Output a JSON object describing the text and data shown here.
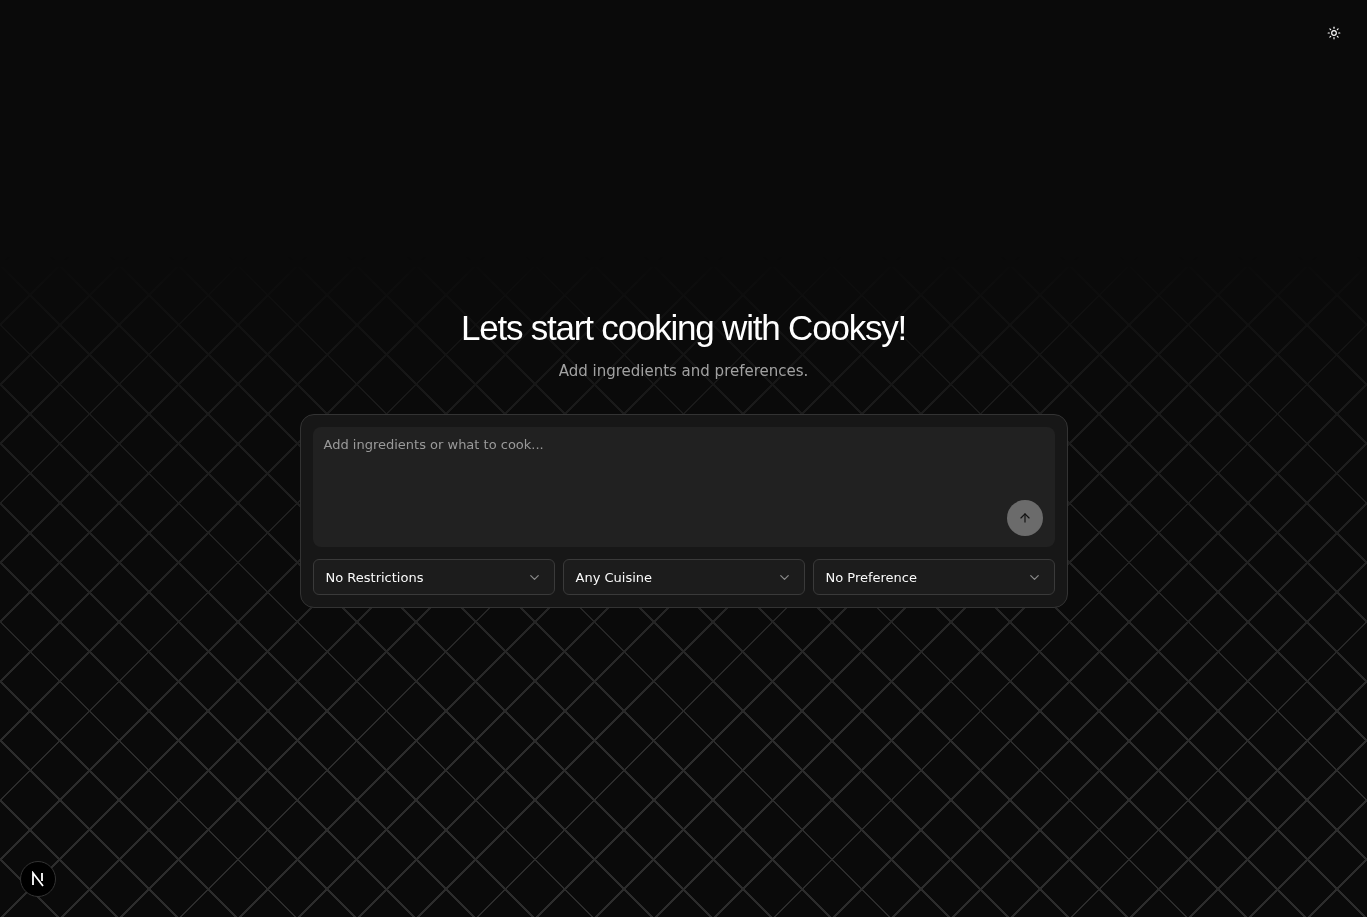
{
  "heading": "Lets start cooking with Cooksy!",
  "subheading": "Add ingredients and preferences.",
  "prompt": {
    "placeholder": "Add ingredients or what to cook...",
    "submit_disabled": true
  },
  "filters": [
    {
      "value": "No Restrictions"
    },
    {
      "value": "Any Cuisine"
    },
    {
      "value": "No Preference"
    }
  ]
}
